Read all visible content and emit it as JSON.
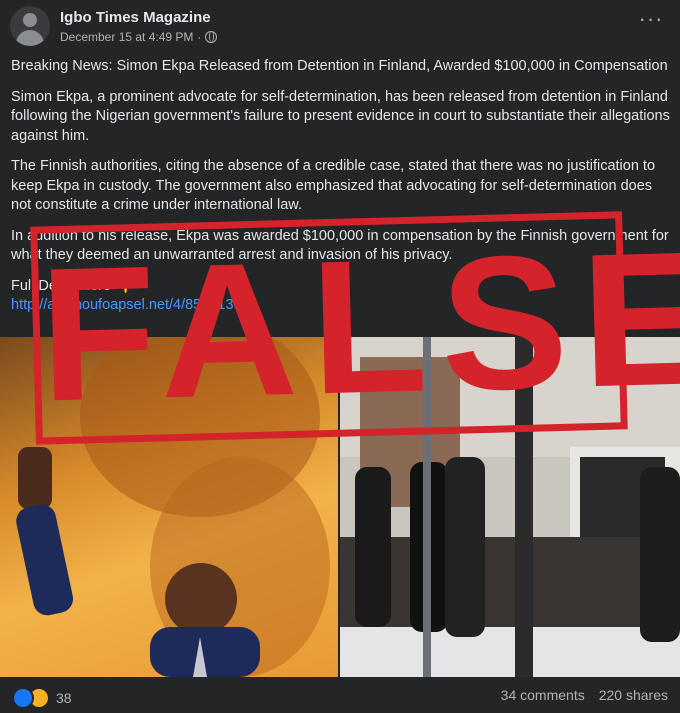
{
  "header": {
    "page_name": "Igbo Times Magazine",
    "timestamp": "December 15 at 4:49 PM",
    "separator": "·",
    "more_label": "···"
  },
  "post": {
    "paragraphs": [
      "Breaking News: Simon Ekpa Released from Detention in Finland, Awarded $100,000 in Compensation",
      "Simon Ekpa, a prominent advocate for self-determination, has been released from detention in Finland following the Nigerian government's failure to present evidence in court to substantiate their allegations against him.",
      "The Finnish authorities, citing the absence of a credible case, stated that there was no justification to keep Ekpa in custody. The government also emphasized that advocating for self-determination does not constitute a crime under international law.",
      "In addition to his release, Ekpa was awarded $100,000 in compensation by the Finnish government for what they deemed an unwarranted arrest and invasion of his privacy."
    ],
    "full_detail": "Full Detail Here 👇",
    "link": "http://ak.choufoapsel.net/4/8508139"
  },
  "stamp": {
    "text": "FALSE",
    "color": "#d4232a"
  },
  "footer": {
    "reaction_count": "38",
    "comments": "34 comments",
    "shares": "220 shares"
  },
  "icons": [
    "gear-icon",
    "globe-icon",
    "like-icon",
    "haha-icon"
  ],
  "colors": {
    "background": "#242526",
    "text": "#e4e6eb",
    "secondary": "#b0b3b8",
    "link": "#4599ff",
    "like": "#1877f2"
  }
}
